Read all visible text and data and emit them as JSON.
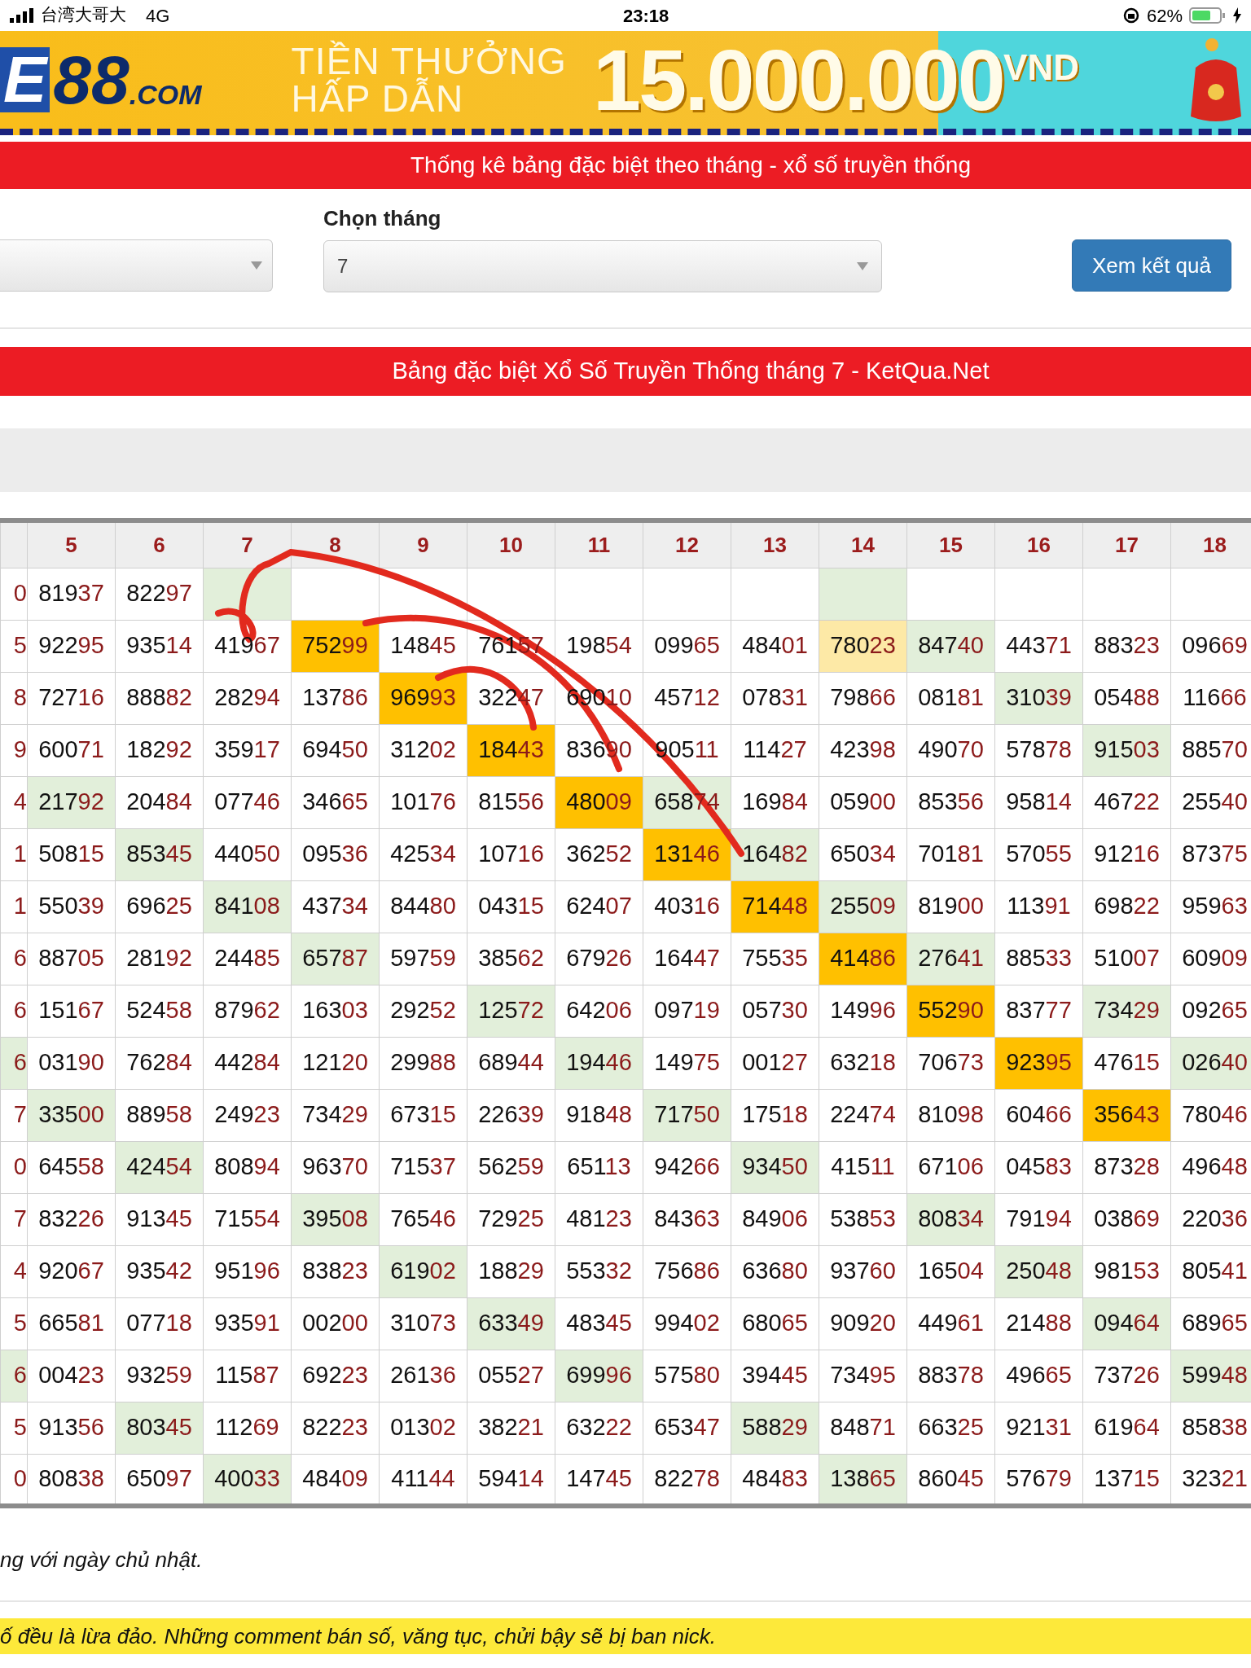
{
  "status_bar": {
    "carrier": "台湾大哥大",
    "network": "4G",
    "time": "23:18",
    "battery": "62%"
  },
  "banner": {
    "logo_letter": "E",
    "logo_number": "88",
    "logo_domain": ".COM",
    "headline_1": "TIỀN THƯỞNG",
    "headline_2": "HẤP DẪN",
    "amount": "15.000.000",
    "currency": "VND"
  },
  "page_title": "Thống kê bảng đặc biệt theo tháng - xổ số truyền thống",
  "form": {
    "month_label": "Chọn tháng",
    "month_value": "7",
    "submit": "Xem kết quả"
  },
  "table_title": "Bảng đặc biệt Xổ Số Truyền Thống tháng 7 - KetQua.Net",
  "table": {
    "columns": [
      "5",
      "6",
      "7",
      "8",
      "9",
      "10",
      "11",
      "12",
      "13",
      "14",
      "15",
      "16",
      "17",
      "18"
    ],
    "rows": [
      {
        "edge": {
          "value": "0",
          "color": "#ffffff"
        },
        "cells": [
          {
            "value": "81937",
            "color": "#ffffff"
          },
          {
            "value": "82297",
            "color": "#ffffff"
          },
          {
            "color": "#e2efda"
          },
          {
            "color": "#ffffff"
          },
          {
            "color": "#ffffff"
          },
          {
            "color": "#ffffff"
          },
          {
            "color": "#ffffff"
          },
          {
            "color": "#ffffff"
          },
          {
            "color": "#ffffff"
          },
          {
            "color": "#e2efda"
          },
          {
            "color": "#ffffff"
          },
          {
            "color": "#ffffff"
          },
          {
            "color": "#ffffff"
          },
          {
            "color": "#ffffff"
          }
        ]
      },
      {
        "edge": {
          "value": "5",
          "color": "#ffffff"
        },
        "cells": [
          {
            "value": "92295",
            "color": "#ffffff"
          },
          {
            "value": "93514",
            "color": "#ffffff"
          },
          {
            "value": "41967",
            "color": "#ffffff"
          },
          {
            "value": "75299",
            "color": "#ffc000"
          },
          {
            "value": "14845",
            "color": "#ffffff"
          },
          {
            "value": "76157",
            "color": "#ffffff"
          },
          {
            "value": "19854",
            "color": "#ffffff"
          },
          {
            "value": "09965",
            "color": "#ffffff"
          },
          {
            "value": "48401",
            "color": "#ffffff"
          },
          {
            "value": "78023",
            "color": "#fde9a6"
          },
          {
            "value": "84740",
            "color": "#e2efda"
          },
          {
            "value": "44371",
            "color": "#ffffff"
          },
          {
            "value": "88323",
            "color": "#ffffff"
          },
          {
            "value": "09669",
            "color": "#ffffff"
          }
        ]
      },
      {
        "edge": {
          "value": "8",
          "color": "#ffffff"
        },
        "cells": [
          {
            "value": "72716",
            "color": "#ffffff"
          },
          {
            "value": "88882",
            "color": "#ffffff"
          },
          {
            "value": "28294",
            "color": "#ffffff"
          },
          {
            "value": "13786",
            "color": "#ffffff"
          },
          {
            "value": "96993",
            "color": "#ffc000"
          },
          {
            "value": "32247",
            "color": "#ffffff"
          },
          {
            "value": "69010",
            "color": "#ffffff"
          },
          {
            "value": "45712",
            "color": "#ffffff"
          },
          {
            "value": "07831",
            "color": "#ffffff"
          },
          {
            "value": "79866",
            "color": "#ffffff"
          },
          {
            "value": "08181",
            "color": "#ffffff"
          },
          {
            "value": "31039",
            "color": "#e2efda"
          },
          {
            "value": "05488",
            "color": "#ffffff"
          },
          {
            "value": "11666",
            "color": "#ffffff"
          }
        ]
      },
      {
        "edge": {
          "value": "9",
          "color": "#ffffff"
        },
        "cells": [
          {
            "value": "60071",
            "color": "#ffffff"
          },
          {
            "value": "18292",
            "color": "#ffffff"
          },
          {
            "value": "35917",
            "color": "#ffffff"
          },
          {
            "value": "69450",
            "color": "#ffffff"
          },
          {
            "value": "31202",
            "color": "#ffffff"
          },
          {
            "value": "18443",
            "color": "#ffc000"
          },
          {
            "value": "83690",
            "color": "#ffffff"
          },
          {
            "value": "90511",
            "color": "#ffffff"
          },
          {
            "value": "11427",
            "color": "#ffffff"
          },
          {
            "value": "42398",
            "color": "#ffffff"
          },
          {
            "value": "49070",
            "color": "#ffffff"
          },
          {
            "value": "57878",
            "color": "#ffffff"
          },
          {
            "value": "91503",
            "color": "#e2efda"
          },
          {
            "value": "88570",
            "color": "#ffffff"
          }
        ]
      },
      {
        "edge": {
          "value": "4",
          "color": "#ffffff"
        },
        "cells": [
          {
            "value": "21792",
            "color": "#e2efda"
          },
          {
            "value": "20484",
            "color": "#ffffff"
          },
          {
            "value": "07746",
            "color": "#ffffff"
          },
          {
            "value": "34665",
            "color": "#ffffff"
          },
          {
            "value": "10176",
            "color": "#ffffff"
          },
          {
            "value": "81556",
            "color": "#ffffff"
          },
          {
            "value": "48009",
            "color": "#ffc000"
          },
          {
            "value": "65874",
            "color": "#e2efda"
          },
          {
            "value": "16984",
            "color": "#ffffff"
          },
          {
            "value": "05900",
            "color": "#ffffff"
          },
          {
            "value": "85356",
            "color": "#ffffff"
          },
          {
            "value": "95814",
            "color": "#ffffff"
          },
          {
            "value": "46722",
            "color": "#ffffff"
          },
          {
            "value": "25540",
            "color": "#ffffff"
          }
        ]
      },
      {
        "edge": {
          "value": "1",
          "color": "#ffffff"
        },
        "cells": [
          {
            "value": "50815",
            "color": "#ffffff"
          },
          {
            "value": "85345",
            "color": "#e2efda"
          },
          {
            "value": "44050",
            "color": "#ffffff"
          },
          {
            "value": "09536",
            "color": "#ffffff"
          },
          {
            "value": "42534",
            "color": "#ffffff"
          },
          {
            "value": "10716",
            "color": "#ffffff"
          },
          {
            "value": "36252",
            "color": "#ffffff"
          },
          {
            "value": "13146",
            "color": "#ffc000"
          },
          {
            "value": "16482",
            "color": "#e2efda"
          },
          {
            "value": "65034",
            "color": "#ffffff"
          },
          {
            "value": "70181",
            "color": "#ffffff"
          },
          {
            "value": "57055",
            "color": "#ffffff"
          },
          {
            "value": "91216",
            "color": "#ffffff"
          },
          {
            "value": "87375",
            "color": "#ffffff"
          }
        ]
      },
      {
        "edge": {
          "value": "1",
          "color": "#ffffff"
        },
        "cells": [
          {
            "value": "55039",
            "color": "#ffffff"
          },
          {
            "value": "69625",
            "color": "#ffffff"
          },
          {
            "value": "84108",
            "color": "#e2efda"
          },
          {
            "value": "43734",
            "color": "#ffffff"
          },
          {
            "value": "84480",
            "color": "#ffffff"
          },
          {
            "value": "04315",
            "color": "#ffffff"
          },
          {
            "value": "62407",
            "color": "#ffffff"
          },
          {
            "value": "40316",
            "color": "#ffffff"
          },
          {
            "value": "71448",
            "color": "#ffc000"
          },
          {
            "value": "25509",
            "color": "#e2efda"
          },
          {
            "value": "81900",
            "color": "#ffffff"
          },
          {
            "value": "11391",
            "color": "#ffffff"
          },
          {
            "value": "69822",
            "color": "#ffffff"
          },
          {
            "value": "95963",
            "color": "#ffffff"
          }
        ]
      },
      {
        "edge": {
          "value": "6",
          "color": "#ffffff"
        },
        "cells": [
          {
            "value": "88705",
            "color": "#ffffff"
          },
          {
            "value": "28192",
            "color": "#ffffff"
          },
          {
            "value": "24485",
            "color": "#ffffff"
          },
          {
            "value": "65787",
            "color": "#e2efda"
          },
          {
            "value": "59759",
            "color": "#ffffff"
          },
          {
            "value": "38562",
            "color": "#ffffff"
          },
          {
            "value": "67926",
            "color": "#ffffff"
          },
          {
            "value": "16447",
            "color": "#ffffff"
          },
          {
            "value": "75535",
            "color": "#ffffff"
          },
          {
            "value": "41486",
            "color": "#ffc000"
          },
          {
            "value": "27641",
            "color": "#e2efda"
          },
          {
            "value": "88533",
            "color": "#ffffff"
          },
          {
            "value": "51007",
            "color": "#ffffff"
          },
          {
            "value": "60909",
            "color": "#ffffff"
          }
        ]
      },
      {
        "edge": {
          "value": "6",
          "color": "#ffffff"
        },
        "cells": [
          {
            "value": "15167",
            "color": "#ffffff"
          },
          {
            "value": "52458",
            "color": "#ffffff"
          },
          {
            "value": "87962",
            "color": "#ffffff"
          },
          {
            "value": "16303",
            "color": "#ffffff"
          },
          {
            "value": "29252",
            "color": "#ffffff"
          },
          {
            "value": "12572",
            "color": "#e2efda"
          },
          {
            "value": "64206",
            "color": "#ffffff"
          },
          {
            "value": "09719",
            "color": "#ffffff"
          },
          {
            "value": "05730",
            "color": "#ffffff"
          },
          {
            "value": "14996",
            "color": "#ffffff"
          },
          {
            "value": "55290",
            "color": "#ffc000"
          },
          {
            "value": "83777",
            "color": "#ffffff"
          },
          {
            "value": "73429",
            "color": "#e2efda"
          },
          {
            "value": "09265",
            "color": "#ffffff"
          }
        ]
      },
      {
        "edge": {
          "value": "6",
          "color": "#e2efda"
        },
        "cells": [
          {
            "value": "03190",
            "color": "#ffffff"
          },
          {
            "value": "76284",
            "color": "#ffffff"
          },
          {
            "value": "44284",
            "color": "#ffffff"
          },
          {
            "value": "12120",
            "color": "#ffffff"
          },
          {
            "value": "29988",
            "color": "#ffffff"
          },
          {
            "value": "68944",
            "color": "#ffffff"
          },
          {
            "value": "19446",
            "color": "#e2efda"
          },
          {
            "value": "14975",
            "color": "#ffffff"
          },
          {
            "value": "00127",
            "color": "#ffffff"
          },
          {
            "value": "63218",
            "color": "#ffffff"
          },
          {
            "value": "70673",
            "color": "#ffffff"
          },
          {
            "value": "92395",
            "color": "#ffc000"
          },
          {
            "value": "47615",
            "color": "#ffffff"
          },
          {
            "value": "02640",
            "color": "#e2efda"
          }
        ]
      },
      {
        "edge": {
          "value": "7",
          "color": "#ffffff"
        },
        "cells": [
          {
            "value": "33500",
            "color": "#e2efda"
          },
          {
            "value": "88958",
            "color": "#ffffff"
          },
          {
            "value": "24923",
            "color": "#ffffff"
          },
          {
            "value": "73429",
            "color": "#ffffff"
          },
          {
            "value": "67315",
            "color": "#ffffff"
          },
          {
            "value": "22639",
            "color": "#ffffff"
          },
          {
            "value": "91848",
            "color": "#ffffff"
          },
          {
            "value": "71750",
            "color": "#e2efda"
          },
          {
            "value": "17518",
            "color": "#ffffff"
          },
          {
            "value": "22474",
            "color": "#ffffff"
          },
          {
            "value": "81098",
            "color": "#ffffff"
          },
          {
            "value": "60466",
            "color": "#ffffff"
          },
          {
            "value": "35643",
            "color": "#ffc000"
          },
          {
            "value": "78046",
            "color": "#ffffff"
          }
        ]
      },
      {
        "edge": {
          "value": "0",
          "color": "#ffffff"
        },
        "cells": [
          {
            "value": "64558",
            "color": "#ffffff"
          },
          {
            "value": "42454",
            "color": "#e2efda"
          },
          {
            "value": "80894",
            "color": "#ffffff"
          },
          {
            "value": "96370",
            "color": "#ffffff"
          },
          {
            "value": "71537",
            "color": "#ffffff"
          },
          {
            "value": "56259",
            "color": "#ffffff"
          },
          {
            "value": "65113",
            "color": "#ffffff"
          },
          {
            "value": "94266",
            "color": "#ffffff"
          },
          {
            "value": "93450",
            "color": "#e2efda"
          },
          {
            "value": "41511",
            "color": "#ffffff"
          },
          {
            "value": "67106",
            "color": "#ffffff"
          },
          {
            "value": "04583",
            "color": "#ffffff"
          },
          {
            "value": "87328",
            "color": "#ffffff"
          },
          {
            "value": "49648",
            "color": "#ffffff"
          }
        ]
      },
      {
        "edge": {
          "value": "7",
          "color": "#ffffff"
        },
        "cells": [
          {
            "value": "83226",
            "color": "#ffffff"
          },
          {
            "value": "91345",
            "color": "#ffffff"
          },
          {
            "value": "71554",
            "color": "#ffffff"
          },
          {
            "value": "39508",
            "color": "#e2efda"
          },
          {
            "value": "76546",
            "color": "#ffffff"
          },
          {
            "value": "72925",
            "color": "#ffffff"
          },
          {
            "value": "48123",
            "color": "#ffffff"
          },
          {
            "value": "84363",
            "color": "#ffffff"
          },
          {
            "value": "84906",
            "color": "#ffffff"
          },
          {
            "value": "53853",
            "color": "#ffffff"
          },
          {
            "value": "80834",
            "color": "#e2efda"
          },
          {
            "value": "79194",
            "color": "#ffffff"
          },
          {
            "value": "03869",
            "color": "#ffffff"
          },
          {
            "value": "22036",
            "color": "#ffffff"
          }
        ]
      },
      {
        "edge": {
          "value": "4",
          "color": "#ffffff"
        },
        "cells": [
          {
            "value": "92067",
            "color": "#ffffff"
          },
          {
            "value": "93542",
            "color": "#ffffff"
          },
          {
            "value": "95196",
            "color": "#ffffff"
          },
          {
            "value": "83823",
            "color": "#ffffff"
          },
          {
            "value": "61902",
            "color": "#e2efda"
          },
          {
            "value": "18829",
            "color": "#ffffff"
          },
          {
            "value": "55332",
            "color": "#ffffff"
          },
          {
            "value": "75686",
            "color": "#ffffff"
          },
          {
            "value": "63680",
            "color": "#ffffff"
          },
          {
            "value": "93760",
            "color": "#ffffff"
          },
          {
            "value": "16504",
            "color": "#ffffff"
          },
          {
            "value": "25048",
            "color": "#e2efda"
          },
          {
            "value": "98153",
            "color": "#ffffff"
          },
          {
            "value": "80541",
            "color": "#ffffff"
          }
        ]
      },
      {
        "edge": {
          "value": "5",
          "color": "#ffffff"
        },
        "cells": [
          {
            "value": "66581",
            "color": "#ffffff"
          },
          {
            "value": "07718",
            "color": "#ffffff"
          },
          {
            "value": "93591",
            "color": "#ffffff"
          },
          {
            "value": "00200",
            "color": "#ffffff"
          },
          {
            "value": "31073",
            "color": "#ffffff"
          },
          {
            "value": "63349",
            "color": "#e2efda"
          },
          {
            "value": "48345",
            "color": "#ffffff"
          },
          {
            "value": "99402",
            "color": "#ffffff"
          },
          {
            "value": "68065",
            "color": "#ffffff"
          },
          {
            "value": "90920",
            "color": "#ffffff"
          },
          {
            "value": "44961",
            "color": "#ffffff"
          },
          {
            "value": "21488",
            "color": "#ffffff"
          },
          {
            "value": "09464",
            "color": "#e2efda"
          },
          {
            "value": "68965",
            "color": "#ffffff"
          }
        ]
      },
      {
        "edge": {
          "value": "6",
          "color": "#e2efda"
        },
        "cells": [
          {
            "value": "00423",
            "color": "#ffffff"
          },
          {
            "value": "93259",
            "color": "#ffffff"
          },
          {
            "value": "11587",
            "color": "#ffffff"
          },
          {
            "value": "69223",
            "color": "#ffffff"
          },
          {
            "value": "26136",
            "color": "#ffffff"
          },
          {
            "value": "05527",
            "color": "#ffffff"
          },
          {
            "value": "69996",
            "color": "#e2efda"
          },
          {
            "value": "57580",
            "color": "#ffffff"
          },
          {
            "value": "39445",
            "color": "#ffffff"
          },
          {
            "value": "73495",
            "color": "#ffffff"
          },
          {
            "value": "88378",
            "color": "#ffffff"
          },
          {
            "value": "49665",
            "color": "#ffffff"
          },
          {
            "value": "73726",
            "color": "#ffffff"
          },
          {
            "value": "59948",
            "color": "#e2efda"
          }
        ]
      },
      {
        "edge": {
          "value": "5",
          "color": "#ffffff"
        },
        "cells": [
          {
            "value": "91356",
            "color": "#ffffff"
          },
          {
            "value": "80345",
            "color": "#e2efda"
          },
          {
            "value": "11269",
            "color": "#ffffff"
          },
          {
            "value": "82223",
            "color": "#ffffff"
          },
          {
            "value": "01302",
            "color": "#ffffff"
          },
          {
            "value": "38221",
            "color": "#ffffff"
          },
          {
            "value": "63222",
            "color": "#ffffff"
          },
          {
            "value": "65347",
            "color": "#ffffff"
          },
          {
            "value": "58829",
            "color": "#e2efda"
          },
          {
            "value": "84871",
            "color": "#ffffff"
          },
          {
            "value": "66325",
            "color": "#ffffff"
          },
          {
            "value": "92131",
            "color": "#ffffff"
          },
          {
            "value": "61964",
            "color": "#ffffff"
          },
          {
            "value": "85838",
            "color": "#ffffff"
          }
        ]
      },
      {
        "edge": {
          "value": "0",
          "color": "#ffffff"
        },
        "cells": [
          {
            "value": "80838",
            "color": "#ffffff"
          },
          {
            "value": "65097",
            "color": "#ffffff"
          },
          {
            "value": "40033",
            "color": "#e2efda"
          },
          {
            "value": "48409",
            "color": "#ffffff"
          },
          {
            "value": "41144",
            "color": "#ffffff"
          },
          {
            "value": "59414",
            "color": "#ffffff"
          },
          {
            "value": "14745",
            "color": "#ffffff"
          },
          {
            "value": "82278",
            "color": "#ffffff"
          },
          {
            "value": "48483",
            "color": "#ffffff"
          },
          {
            "value": "13865",
            "color": "#e2efda"
          },
          {
            "value": "86045",
            "color": "#ffffff"
          },
          {
            "value": "57679",
            "color": "#ffffff"
          },
          {
            "value": "13715",
            "color": "#ffffff"
          },
          {
            "value": "32321",
            "color": "#ffffff"
          }
        ]
      }
    ]
  },
  "note": "ng với ngày chủ nhật.",
  "warning": "ố đều là lừa đảo. Những comment bán số, văng tục, chửi bậy sẽ bị ban nick."
}
